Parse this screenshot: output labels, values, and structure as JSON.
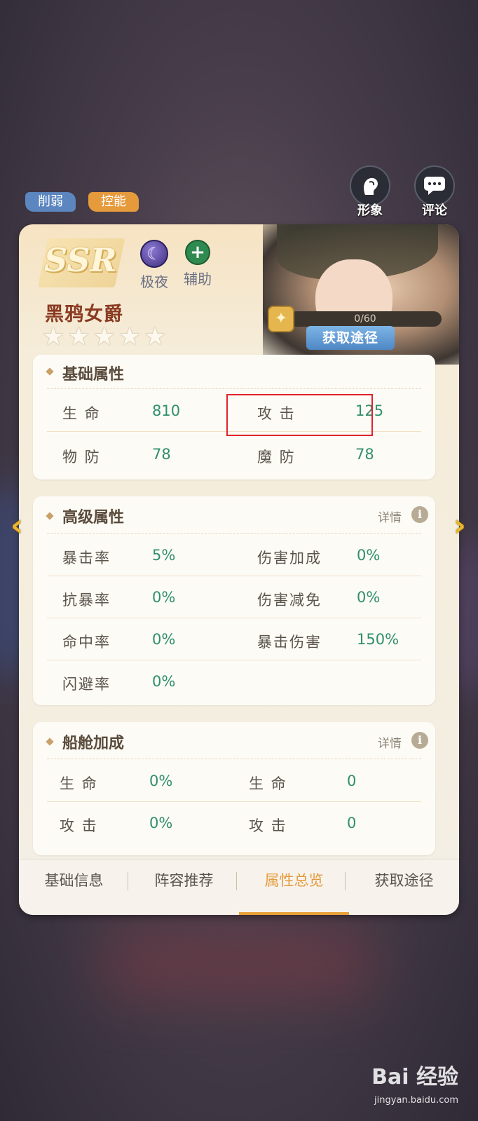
{
  "tags": {
    "weaken": "削弱",
    "control": "控能"
  },
  "top_buttons": {
    "figure": "形象",
    "comment": "评论"
  },
  "hero": {
    "rarity": "SSR",
    "faction": "极夜",
    "role": "辅助",
    "name": "黑鸦女爵",
    "stars_total": 5,
    "fragments": "0/60",
    "obtain_label": "获取途径"
  },
  "basic": {
    "title": "基础属性",
    "rows": [
      {
        "l1": "生 命",
        "v1": "810",
        "l2": "攻 击",
        "v2": "125"
      },
      {
        "l1": "物 防",
        "v1": "78",
        "l2": "魔 防",
        "v2": "78"
      }
    ]
  },
  "advanced": {
    "title": "高级属性",
    "detail": "详情",
    "rows": [
      {
        "l1": "暴击率",
        "v1": "5%",
        "l2": "伤害加成",
        "v2": "0%"
      },
      {
        "l1": "抗暴率",
        "v1": "0%",
        "l2": "伤害减免",
        "v2": "0%"
      },
      {
        "l1": "命中率",
        "v1": "0%",
        "l2": "暴击伤害",
        "v2": "150%"
      },
      {
        "l1": "闪避率",
        "v1": "0%"
      }
    ]
  },
  "ship": {
    "title": "船舱加成",
    "detail": "详情",
    "rows": [
      {
        "l1": "生 命",
        "v1": "0%",
        "l2": "生 命",
        "v2": "0"
      },
      {
        "l1": "攻 击",
        "v1": "0%",
        "l2": "攻 击",
        "v2": "0"
      }
    ]
  },
  "tabs": [
    {
      "label": "基础信息",
      "active": false
    },
    {
      "label": "阵容推荐",
      "active": false
    },
    {
      "label": "属性总览",
      "active": true
    },
    {
      "label": "获取途径",
      "active": false
    }
  ],
  "watermark": {
    "brand": "Bai 经验",
    "url": "jingyan.baidu.com"
  },
  "colors": {
    "accent": "#e59a3c",
    "value_green": "#2f8f6e",
    "highlight_red": "#e0242b"
  }
}
